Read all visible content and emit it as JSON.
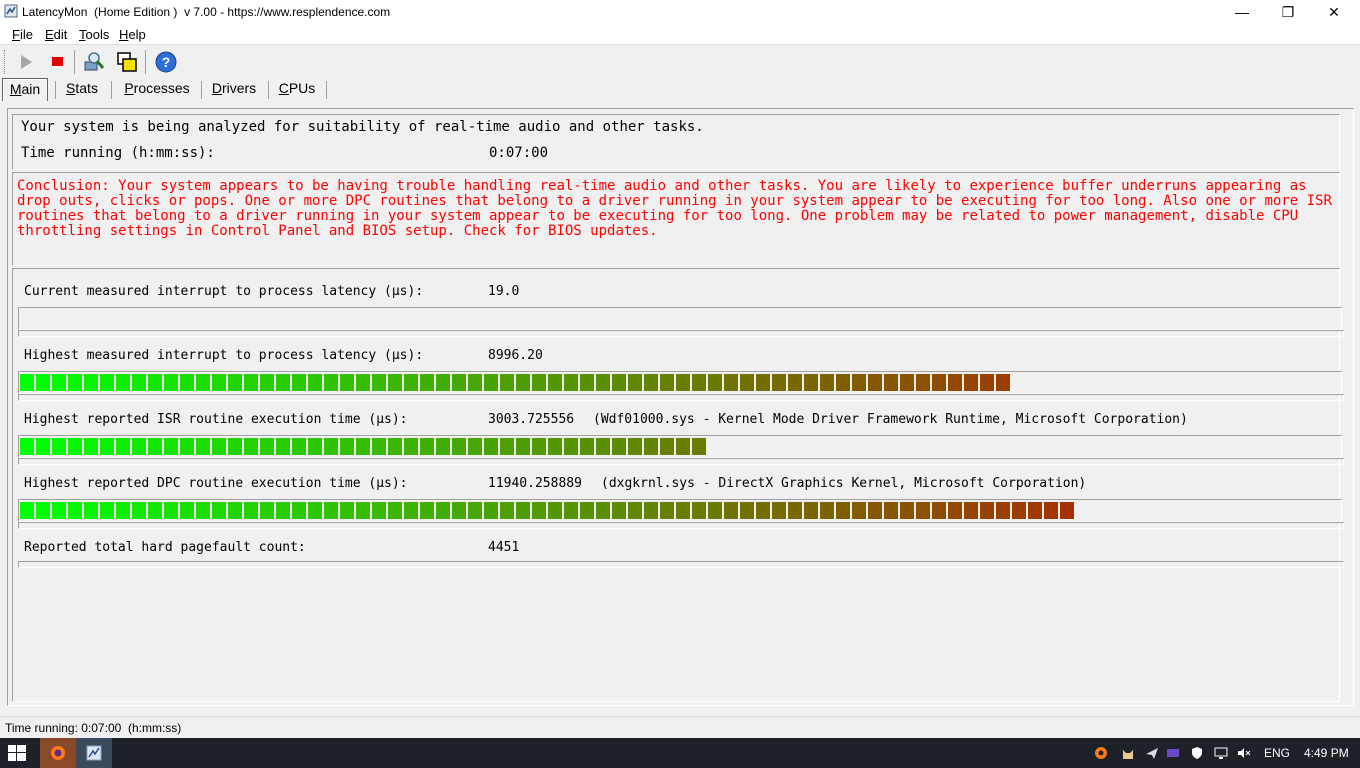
{
  "window": {
    "title": "LatencyMon  (Home Edition )  v 7.00 - https://www.resplendence.com",
    "min_glyph": "—",
    "max_glyph": "❐",
    "close_glyph": "✕"
  },
  "menu": {
    "items": [
      {
        "access": "F",
        "rest": "ile"
      },
      {
        "access": "E",
        "rest": "dit"
      },
      {
        "access": "T",
        "rest": "ools"
      },
      {
        "access": "H",
        "rest": "elp"
      }
    ]
  },
  "toolbar": {
    "icons": [
      "play-icon",
      "stop-icon",
      "analyze-icon",
      "windows-icon",
      "help-icon"
    ]
  },
  "tabs": [
    {
      "access": "M",
      "rest": "ain"
    },
    {
      "access": "S",
      "rest": "tats"
    },
    {
      "access": "P",
      "rest": "rocesses"
    },
    {
      "access": "D",
      "rest": "rivers"
    },
    {
      "access": "C",
      "rest": "PUs"
    }
  ],
  "main": {
    "analyzing_text": "Your system is being analyzed for suitability of real-time audio and other tasks.",
    "time_label": "Time running (h:mm:ss):",
    "time_value": "0:07:00",
    "conclusion": "Conclusion: Your system appears to be having trouble handling real-time audio and other tasks. You are likely to experience buffer underruns appearing as drop outs, clicks or pops. One or more DPC routines that belong to a driver running in your system appear to be executing for too long. Also one or more ISR routines that belong to a driver running in your system appear to be executing for too long. One problem may be related to power management, disable CPU throttling settings in Control Panel and BIOS setup. Check for BIOS updates."
  },
  "metrics": [
    {
      "label": "Current measured interrupt to process latency (µs):",
      "value": "19.0",
      "detail": "",
      "bar_fraction": 0.0
    },
    {
      "label": "Highest measured interrupt to process latency (µs):",
      "value": "8996.20",
      "detail": "",
      "bar_fraction": 0.75
    },
    {
      "label": "Highest reported ISR routine execution time (µs):",
      "value": "3003.725556",
      "detail": "(Wdf01000.sys - Kernel Mode Driver Framework Runtime, Microsoft Corporation)",
      "bar_fraction": 0.52
    },
    {
      "label": "Highest reported DPC routine execution time (µs):",
      "value": "11940.258889",
      "detail": "(dxgkrnl.sys - DirectX Graphics Kernel, Microsoft Corporation)",
      "bar_fraction": 0.81
    },
    {
      "label": "Reported total hard pagefault count:",
      "value": "4451",
      "detail": ""
    }
  ],
  "status": {
    "text": "Time running: 0:07:00  (h:mm:ss)"
  },
  "taskbar": {
    "language": "ENG",
    "clock": "4:49 PM"
  },
  "colors": {
    "conclusion": "#ff0000",
    "bar_start": "#00ff00",
    "bar_end": "#cc0000"
  }
}
